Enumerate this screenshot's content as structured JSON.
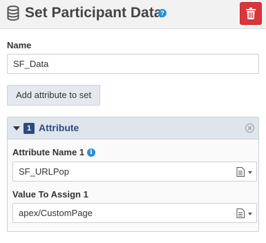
{
  "header": {
    "title": "Set Participant Data",
    "icon": "database-icon",
    "help_glyph": "?",
    "delete_icon": "trash-icon",
    "delete_color": "#d9353a"
  },
  "name_field": {
    "label": "Name",
    "value": "SF_Data"
  },
  "add_button": {
    "label": "Add attribute to set"
  },
  "attribute_panel": {
    "count": "1",
    "title": "Attribute",
    "accent": "#2b4a7e",
    "attribute_name": {
      "label": "Attribute Name 1",
      "value": "SF_URLPop"
    },
    "value_to_assign": {
      "label": "Value To Assign 1",
      "value": "apex/CustomPage"
    }
  }
}
